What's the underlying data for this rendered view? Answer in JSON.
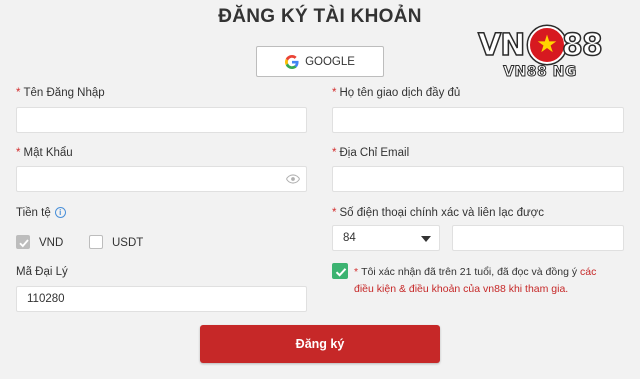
{
  "title": "ĐĂNG KÝ TÀI KHOẢN",
  "google_button": "GOOGLE",
  "logo": {
    "left": "VN",
    "right": "88",
    "sub": "VN88 NG"
  },
  "required_mark": "*",
  "fields": {
    "username": {
      "label": "Tên Đăng Nhập",
      "value": ""
    },
    "fullname": {
      "label": "Họ tên giao dịch đầy đủ",
      "value": ""
    },
    "password": {
      "label": "Mật Khẩu",
      "value": ""
    },
    "email": {
      "label": "Địa Chỉ Email",
      "value": ""
    },
    "phone": {
      "label": "Số điện thoại chính xác và liên lạc được",
      "country_code": "84",
      "value": ""
    },
    "agent_code": {
      "label": "Mã Đại Lý",
      "value": "110280"
    }
  },
  "currency": {
    "label": "Tiền tệ",
    "info_glyph": "i",
    "options": [
      {
        "label": "VND",
        "checked": true
      },
      {
        "label": "USDT",
        "checked": false
      }
    ]
  },
  "agreement": {
    "text": "Tôi xác nhận đã trên 21 tuổi, đã đọc và đồng ý",
    "link": "các điều kiện & điều khoản của vn88 khi tham gia.",
    "checked": true
  },
  "submit_label": "Đăng ký",
  "colors": {
    "accent": "#c62828",
    "check": "#3cb371",
    "required": "#d32f2f"
  }
}
